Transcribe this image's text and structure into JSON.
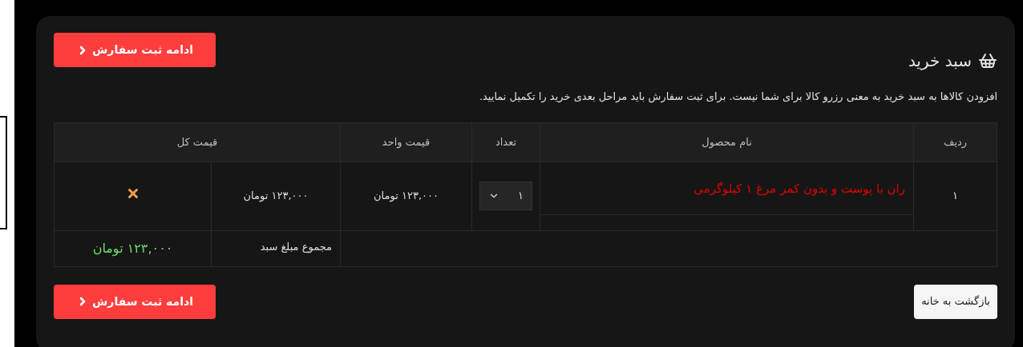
{
  "top_button": {
    "label": "ادامه ثبت سفارش"
  },
  "title": "سبد خرید",
  "notice": "افزودن کالاها به سبد خرید به معنی رزرو کالا برای شما نیست. برای ثبت سفارش باید مراحل بعدی خرید را تکمیل نمایید.",
  "table": {
    "columns": [
      "ردیف",
      "نام محصول",
      "تعداد",
      "قیمت واحد",
      "قیمت کل"
    ],
    "rows": [
      {
        "index": "۱",
        "name": "ران با پوست و بدون کمر مرغ ۱ کیلوگرمی",
        "quantity": "۱",
        "unit_price": "۱۲۳,۰۰۰ تومان",
        "total_price": "۱۲۳,۰۰۰ تومان"
      }
    ]
  },
  "summary": {
    "label": "مجموع مبلغ سبد",
    "value": "۱۲۳,۰۰۰ تومان"
  },
  "back_button": {
    "label": "بازگشت به خانه"
  },
  "bottom_button": {
    "label": "ادامه ثبت سفارش"
  }
}
